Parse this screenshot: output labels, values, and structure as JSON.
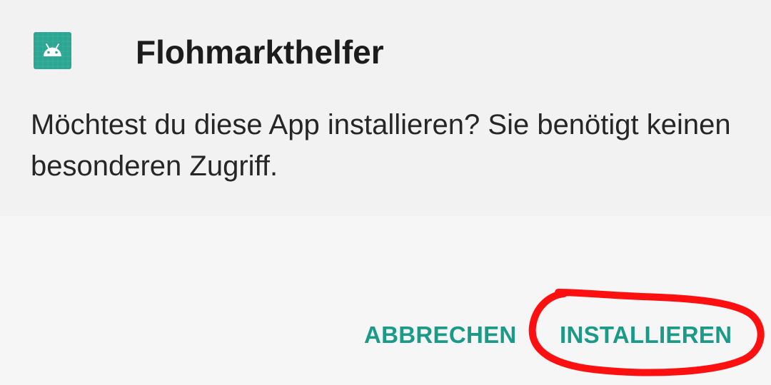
{
  "app": {
    "title": "Flohmarkthelfer",
    "icon": "android-icon"
  },
  "dialog": {
    "message": "Möchtest du diese App installieren? Sie benötigt keinen besonderen Zugriff."
  },
  "buttons": {
    "cancel_label": "ABBRECHEN",
    "install_label": "INSTALLIEREN"
  },
  "colors": {
    "accent": "#1b9a88",
    "icon_background": "#2aa692",
    "annotation": "#ff1010",
    "header_background": "#f2f2f2",
    "footer_background": "#f6f6f6"
  }
}
